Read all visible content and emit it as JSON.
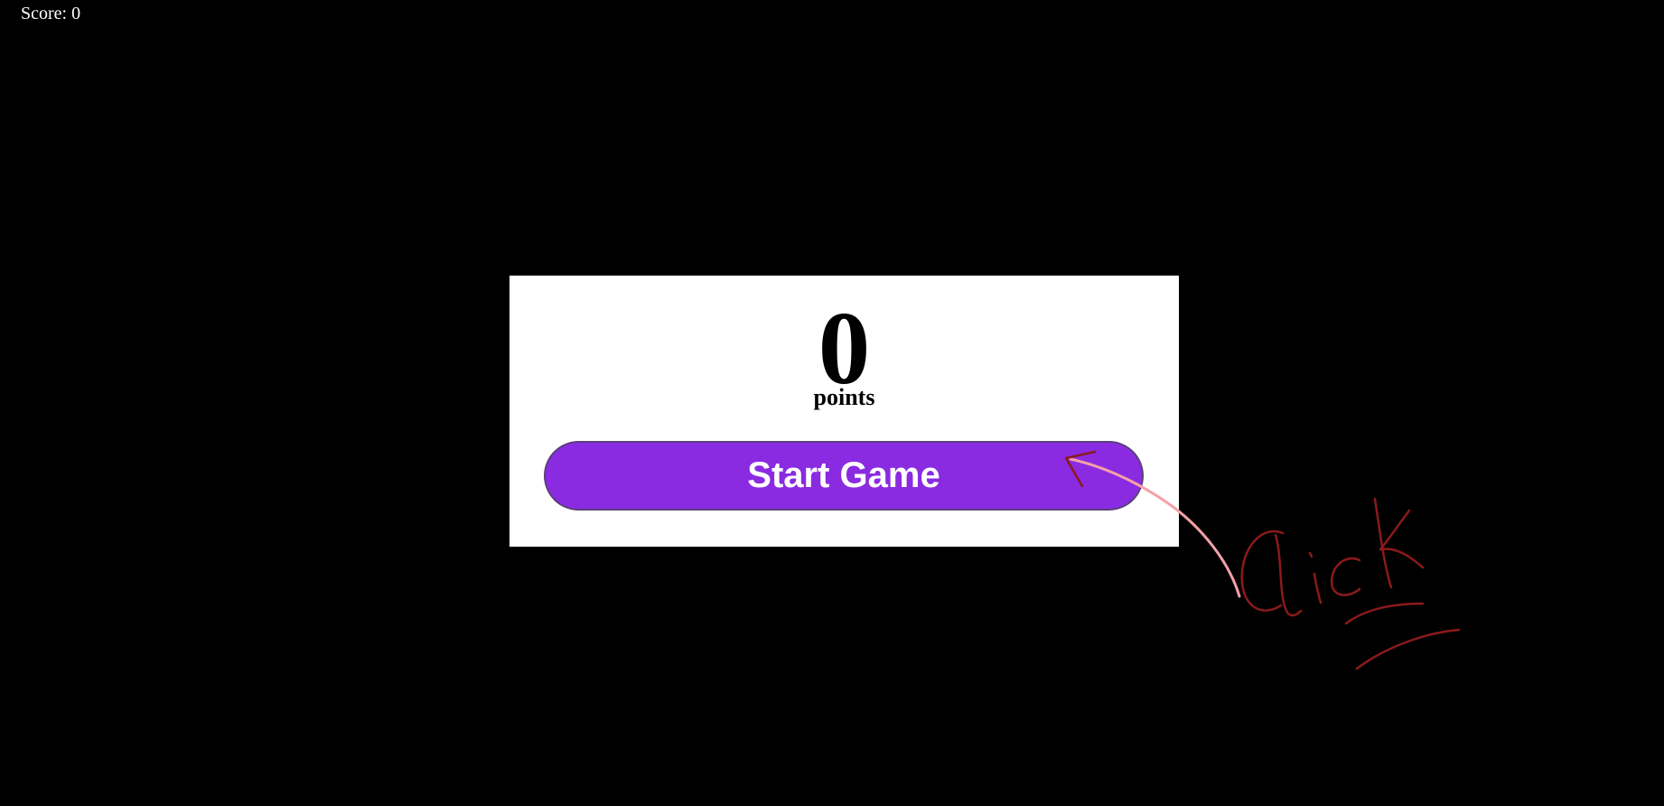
{
  "hud": {
    "score_label": "Score:",
    "score_value": "0"
  },
  "panel": {
    "score": "0",
    "points_label": "points",
    "start_button_label": "Start Game"
  },
  "colors": {
    "background": "#000000",
    "panel": "#ffffff",
    "button": "#8a2be2",
    "annotation_arrow": "#f4a0a8",
    "annotation_text": "#8b1a1a"
  }
}
